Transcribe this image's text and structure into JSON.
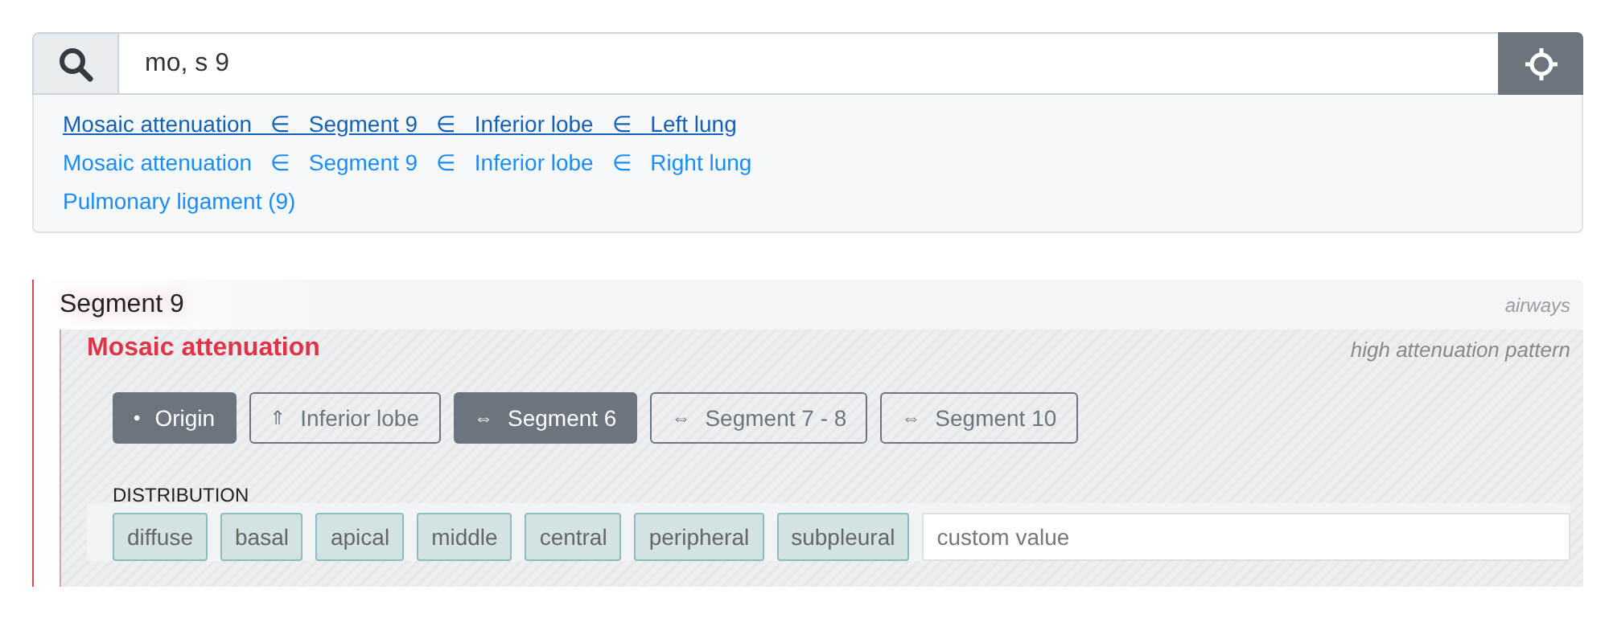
{
  "search": {
    "value": "mo, s 9"
  },
  "suggestions": [
    {
      "text": "Mosaic attenuation   ∈   Segment 9   ∈   Inferior lobe   ∈   Left lung",
      "selected": true
    },
    {
      "text": "Mosaic attenuation   ∈   Segment 9   ∈   Inferior lobe   ∈   Right lung",
      "selected": false
    },
    {
      "text": "Pulmonary ligament (9)",
      "selected": false
    }
  ],
  "section": {
    "title": "Segment 9",
    "category": "airways",
    "finding": {
      "title": "Mosaic attenuation",
      "description": "high attenuation pattern",
      "locations": [
        {
          "symbol": "•",
          "label": "Origin",
          "selected": true
        },
        {
          "symbol": "⇑",
          "label": "Inferior lobe",
          "selected": false
        },
        {
          "symbol": "⇔",
          "label": "Segment 6",
          "selected": true
        },
        {
          "symbol": "⇔",
          "label": "Segment 7 - 8",
          "selected": false
        },
        {
          "symbol": "⇔",
          "label": "Segment 10",
          "selected": false
        }
      ],
      "distribution": {
        "label": "DISTRIBUTION",
        "options": [
          {
            "label": "diffuse",
            "selected": false
          },
          {
            "label": "basal",
            "selected": false
          },
          {
            "label": "apical",
            "selected": false
          },
          {
            "label": "middle",
            "selected": false
          },
          {
            "label": "central",
            "selected": false
          },
          {
            "label": "peripheral",
            "selected": false
          },
          {
            "label": "subpleural",
            "selected": false
          }
        ],
        "placeholder": "custom value"
      }
    }
  }
}
